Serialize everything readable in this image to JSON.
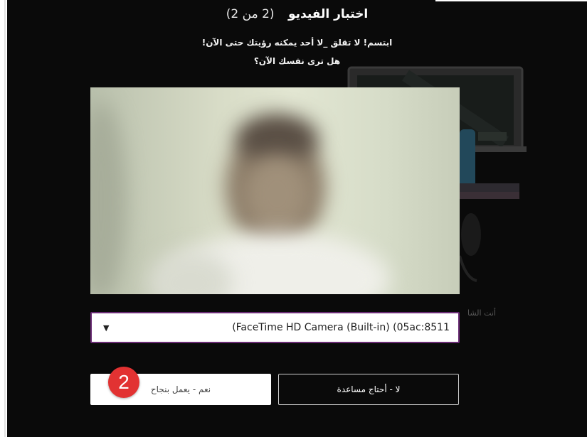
{
  "dialog": {
    "title": "اختبار الفيديو",
    "step_text": "(2 من 2)",
    "line1": "ابتسم! لا تقلق _لا أحد يمكنه رؤيتك حتى الآن!",
    "line2": "هل ترى نفسك الآن؟",
    "background_peek_text": "أنت الشا"
  },
  "camera": {
    "selected": "(FaceTime HD Camera (Built-in) (05ac:8511"
  },
  "buttons": {
    "yes_label": "نعم - يعمل بنجاح",
    "no_label": "لا - أحتاج مساعدة"
  },
  "annotation": {
    "step_number": "2"
  },
  "colors": {
    "panel_bg": "#0a0a0a",
    "select_border": "#6a2c75",
    "badge": "#e23232"
  }
}
